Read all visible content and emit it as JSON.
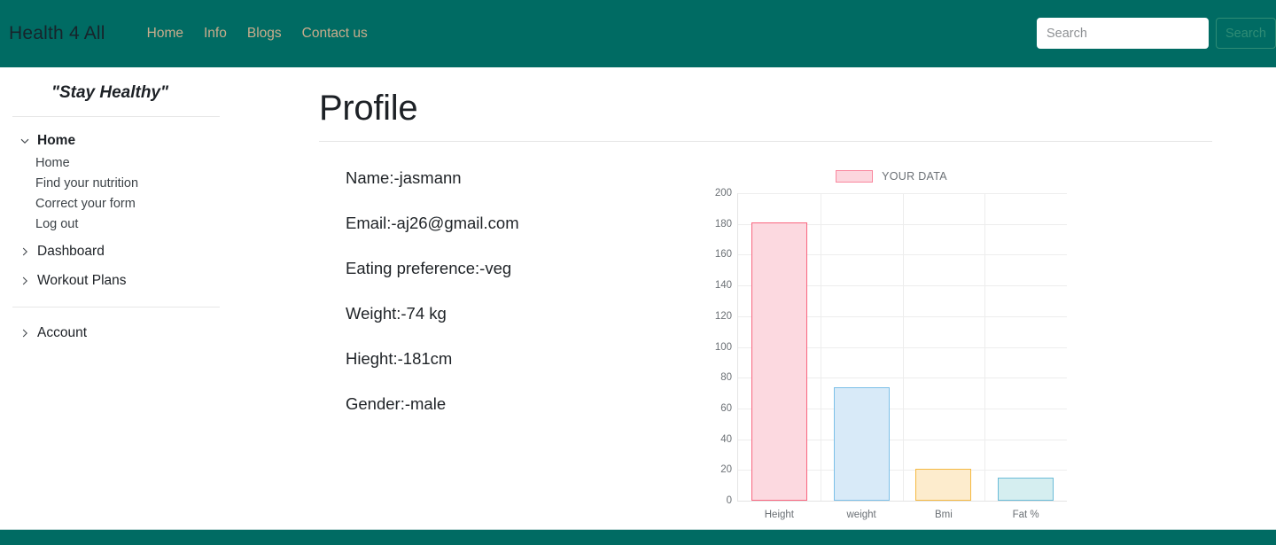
{
  "navbar": {
    "brand": "Health 4 All",
    "links": [
      {
        "label": "Home",
        "name": "nav-link-home"
      },
      {
        "label": "Info",
        "name": "nav-link-info"
      },
      {
        "label": "Blogs",
        "name": "nav-link-blogs"
      },
      {
        "label": "Contact us",
        "name": "nav-link-contact-us"
      }
    ],
    "search": {
      "placeholder": "Search",
      "value": "",
      "button_label": "Search"
    },
    "background_color": "#006b63",
    "link_color": "#c9ac8c"
  },
  "sidebar": {
    "title": "\"Stay Healthy\"",
    "groups": [
      {
        "label": "Home",
        "expanded": true,
        "icon": "chevron-down-icon",
        "children": [
          {
            "label": "Home"
          },
          {
            "label": "Find your nutrition"
          },
          {
            "label": "Correct your form"
          },
          {
            "label": "Log out"
          }
        ]
      },
      {
        "label": "Dashboard",
        "expanded": false,
        "icon": "chevron-right-icon",
        "children": []
      },
      {
        "label": "Workout Plans",
        "expanded": false,
        "icon": "chevron-right-icon",
        "children": []
      }
    ],
    "account": {
      "label": "Account",
      "expanded": false,
      "icon": "chevron-right-icon"
    }
  },
  "main": {
    "page_title": "Profile",
    "profile": [
      {
        "text": "Name:-jasmann"
      },
      {
        "text": "Email:-aj26@gmail.com"
      },
      {
        "text": "Eating preference:-veg"
      },
      {
        "text": "Weight:-74 kg"
      },
      {
        "text": "Hieght:-181cm"
      },
      {
        "text": "Gender:-male"
      }
    ]
  },
  "chart_data": {
    "type": "bar",
    "title": "",
    "xlabel": "",
    "ylabel": "",
    "categories": [
      "Height",
      "weight",
      "Bmi",
      "Fat %"
    ],
    "values": [
      181,
      74,
      21,
      15
    ],
    "ylim": [
      0,
      200
    ],
    "yticks": [
      0,
      20,
      40,
      60,
      80,
      100,
      120,
      140,
      160,
      180,
      200
    ],
    "grid": true,
    "legend": {
      "label": "YOUR DATA",
      "position": "top",
      "swatch_color": "#fcd6de"
    },
    "bar_colors": [
      {
        "fill": "#fcd9e0",
        "border": "#f9667f"
      },
      {
        "fill": "#d8eaf8",
        "border": "#7cc0e8"
      },
      {
        "fill": "#fdeccd",
        "border": "#f5b942"
      },
      {
        "fill": "#d5eef0",
        "border": "#6bbcd8"
      }
    ]
  },
  "footer": {
    "background_color": "#006b63"
  }
}
